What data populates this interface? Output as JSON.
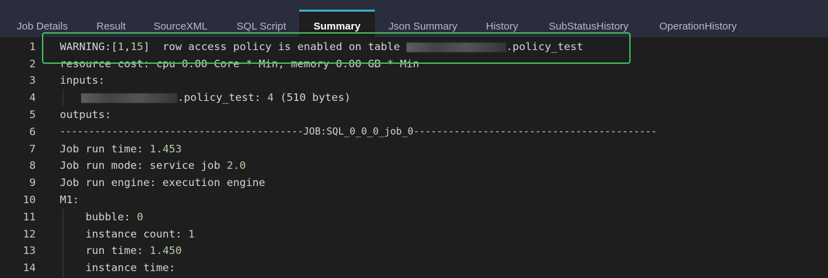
{
  "tabs": [
    {
      "label": "Job Details",
      "active": false
    },
    {
      "label": "Result",
      "active": false
    },
    {
      "label": "SourceXML",
      "active": false
    },
    {
      "label": "SQL Script",
      "active": false
    },
    {
      "label": "Summary",
      "active": true
    },
    {
      "label": "Json Summary",
      "active": false
    },
    {
      "label": "History",
      "active": false
    },
    {
      "label": "SubStatusHistory",
      "active": false
    },
    {
      "label": "OperationHistory",
      "active": false
    }
  ],
  "editor": {
    "line_numbers": [
      "1",
      "2",
      "3",
      "4",
      "5",
      "6",
      "7",
      "8",
      "9",
      "10",
      "11",
      "12",
      "13",
      "14"
    ],
    "lines": {
      "l1_prefix": "WARNING:[",
      "l1_n1": "1",
      "l1_comma": ",",
      "l1_n2": "15",
      "l1_text": "]  row access policy is enabled on table ",
      "l1_suffix": ".policy_test",
      "l2": "resource cost: cpu 0.00 Core * Min, memory 0.00 GB * Min",
      "l3": "inputs:",
      "l4_table": ".policy_test: ",
      "l4_count": "4",
      "l4_rest": " (510 bytes)",
      "l5": "outputs:",
      "l6": "------------------------------------------JOB:SQL_0_0_0_job_0------------------------------------------",
      "l7_label": "Job run time: ",
      "l7_value": "1.453",
      "l8_label": "Job run mode: service job ",
      "l8_value": "2.0",
      "l9": "Job run engine: execution engine",
      "l10": "M1:",
      "l11_label": "    bubble: ",
      "l11_value": "0",
      "l12_label": "    instance count: ",
      "l12_value": "1",
      "l13_label": "    run time: ",
      "l13_value": "1.450",
      "l14": "    instance time:"
    }
  },
  "colors": {
    "tab_active_accent": "#3fa9c8",
    "highlight_box": "#3fbf5a",
    "number_literal": "#b5cea8"
  }
}
